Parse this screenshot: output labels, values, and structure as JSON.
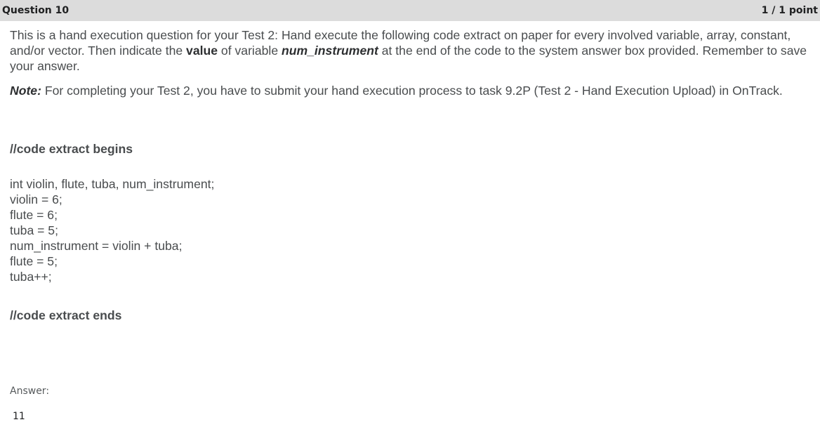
{
  "question": {
    "title": "Question 10",
    "score": "1 / 1 point"
  },
  "instructions": {
    "p1_part1": "This is a hand execution question for your Test 2: Hand execute the following code extract on paper for every involved variable, array, constant, and/or vector. Then indicate the ",
    "p1_bold": "value",
    "p1_part2": " of variable ",
    "p1_bold_italic": "num_instrument",
    "p1_part3": " at the end of the code to the system answer box provided. Remember to save your answer.",
    "note_label": "Note:",
    "note_text": " For completing your Test 2, you have to submit your hand execution process to task 9.2P (Test 2 - Hand Execution Upload) in OnTrack."
  },
  "code": {
    "begin_marker": "//code extract begins",
    "lines": [
      "int violin, flute, tuba, num_instrument;",
      "violin = 6;",
      "flute = 6;",
      "tuba = 5;",
      "num_instrument = violin + tuba;",
      "flute = 5;",
      "tuba++;"
    ],
    "end_marker": "//code extract ends"
  },
  "answer": {
    "label": "Answer:",
    "value": "11"
  }
}
